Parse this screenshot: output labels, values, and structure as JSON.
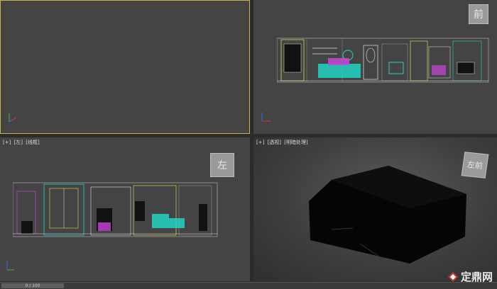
{
  "viewports": {
    "top_left": {
      "label": ""
    },
    "top_right": {
      "view_cube": "前"
    },
    "bottom_left": {
      "label_parts": [
        "[+]",
        "[左]",
        "[线框]"
      ],
      "view_cube": "左"
    },
    "bottom_right": {
      "label_parts": [
        "[+]",
        "[透视]",
        "[明暗处理]"
      ],
      "view_cube": "左前"
    }
  },
  "timeline": {
    "value": "0 / 100"
  },
  "watermark": {
    "text": "定鼎网"
  },
  "colors": {
    "viewport_bg": "#444444",
    "active_border": "#c8b44a",
    "wire_cyan": "#22d3c5",
    "wire_magenta": "#c846d8",
    "wire_yellow": "#d9d94a",
    "wire_white": "#e0e0e0"
  }
}
